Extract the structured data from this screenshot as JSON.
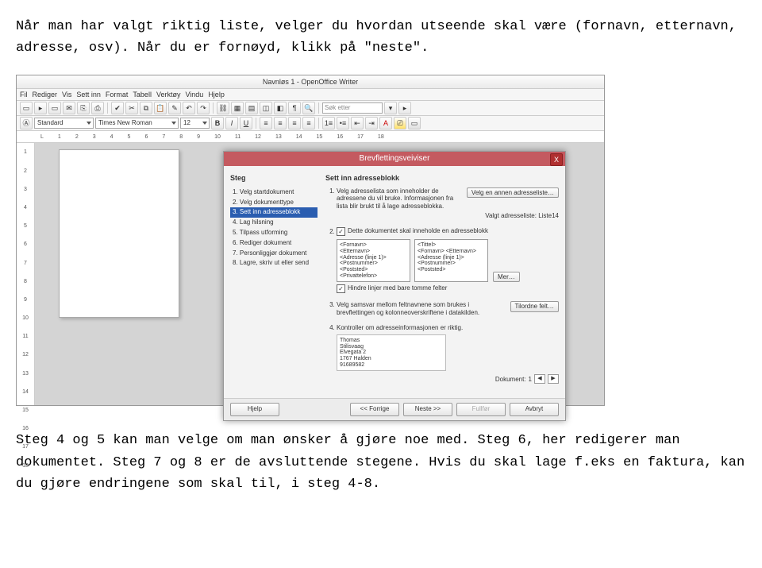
{
  "intro": "Når man har valgt riktig liste, velger du hvordan utseende skal være (fornavn, etternavn, adresse, osv). Når du er fornøyd, klikk på \"neste\".",
  "outro": "Steg 4 og 5 kan man velge om man ønsker å gjøre noe med. Steg 6, her redigerer man dokumentet. Steg 7 og 8 er de avsluttende stegene. Hvis du skal lage f.eks en faktura, kan du gjøre endringene som skal til, i steg 4-8.",
  "app": {
    "title": "Navnløs 1 - OpenOffice Writer",
    "menu": [
      "Fil",
      "Rediger",
      "Vis",
      "Sett inn",
      "Format",
      "Tabell",
      "Verktøy",
      "Vindu",
      "Hjelp"
    ],
    "style": "Standard",
    "fontname": "Times New Roman",
    "fontsize": "12",
    "search_placeholder": "Søk etter",
    "ruler_h": [
      "1",
      "2",
      "3",
      "4",
      "5",
      "6",
      "7",
      "8",
      "9",
      "10",
      "11",
      "12",
      "13",
      "14",
      "15",
      "16",
      "17",
      "18"
    ],
    "ruler_v": [
      "1",
      "2",
      "3",
      "4",
      "5",
      "6",
      "7",
      "8",
      "9",
      "10",
      "11",
      "12",
      "13",
      "14",
      "15",
      "16",
      "17",
      "18"
    ]
  },
  "dialog": {
    "title": "Brevflettingsveiviser",
    "close": "X",
    "left_heading": "Steg",
    "right_heading": "Sett inn adresseblokk",
    "steps": [
      "1. Velg startdokument",
      "2. Velg dokumenttype",
      "3. Sett inn adresseblokk",
      "4. Lag hilsning",
      "5. Tilpass utforming",
      "6. Rediger dokument",
      "7. Personliggjør dokument",
      "8. Lagre, skriv ut eller send"
    ],
    "active": 2,
    "item1_text": "Velg adresselista som inneholder de adressene du vil bruke. Informasjonen fra lista blir brukt til å lage adresseblokka.",
    "item1_btn": "Velg en annen adresseliste…",
    "valgt_label": "Valgt adresseliste: ",
    "valgt_value": "Liste14",
    "item2_chk_label": "Dette dokumentet skal inneholde en adresseblokk",
    "format1": [
      "<Fornavn>",
      "<Etternavn>",
      "<Adresse (linje 1)>",
      "<Postnummer> <Poststed>",
      "<Privattelefon>"
    ],
    "format2": [
      "<Tittel>",
      "<Fornavn> <Etternavn>",
      "<Adresse (linje 1)>",
      "<Postnummer> <Poststed>"
    ],
    "more_btn": "Mer…",
    "hindre_label": "Hindre linjer med bare tomme felter",
    "item3_text": "Velg samsvar mellom feltnavnene som brukes i brevflettingen og kolonneoverskriftene i datakilden.",
    "item3_btn": "Tilordne felt…",
    "item4_text": "Kontroller om adresseinformasjonen er riktig.",
    "preview": [
      "Thomas",
      "Stilisvaag",
      "Elvegata 2",
      "1767 Halden",
      "91689582"
    ],
    "doc_label": "Dokument: ",
    "doc_num": "1",
    "footer": {
      "help": "Hjelp",
      "back": "<< Forrige",
      "next": "Neste >>",
      "finish": "Fullfør",
      "cancel": "Avbryt"
    }
  }
}
